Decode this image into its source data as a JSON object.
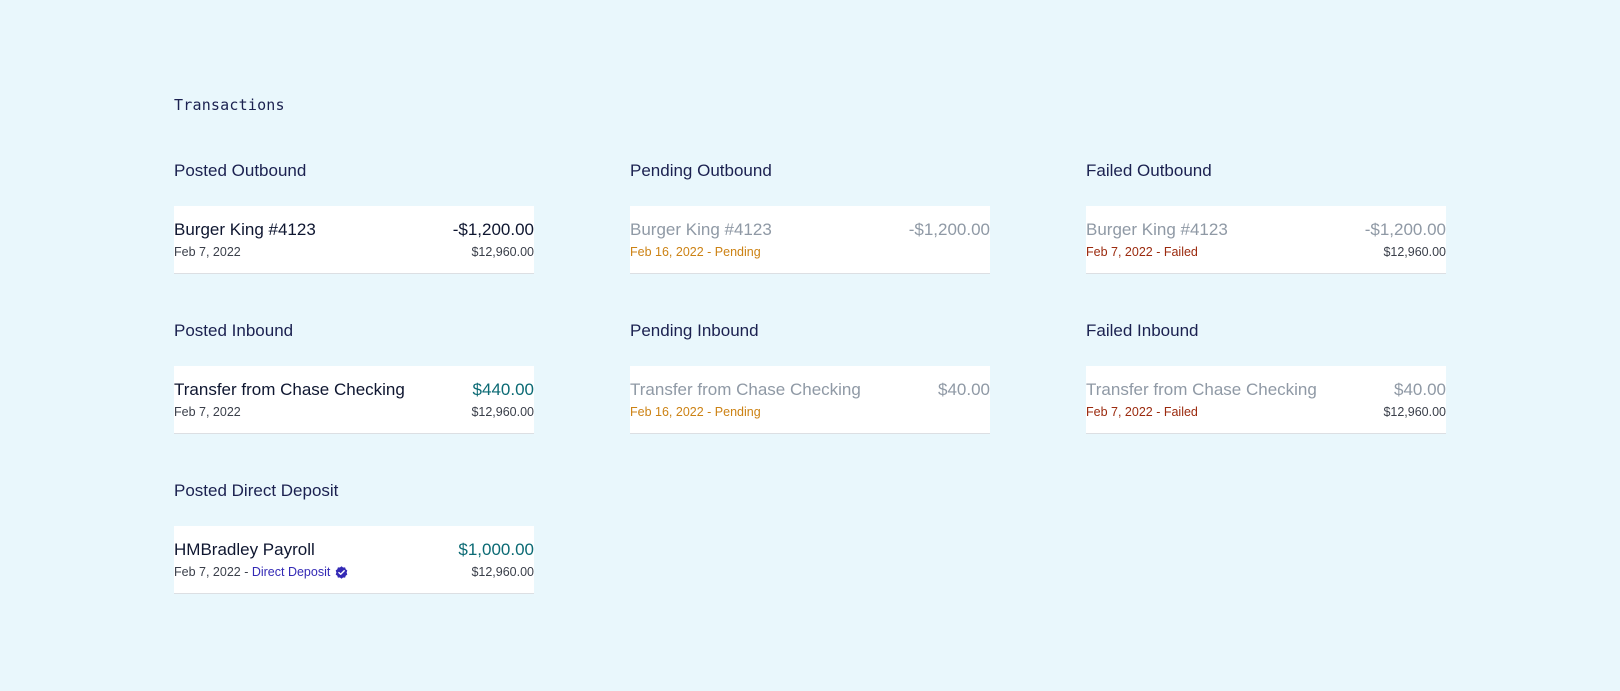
{
  "page_title": "Transactions",
  "sections": [
    {
      "title": "Posted Outbound",
      "description": "Burger King #4123",
      "amount": "-$1,200.00",
      "date": "Feb 7, 2022",
      "balance": "$12,960.00"
    },
    {
      "title": "Pending Outbound",
      "description": "Burger King #4123",
      "amount": "-$1,200.00",
      "date": "Feb 16, 2022 - Pending",
      "balance": ""
    },
    {
      "title": "Failed Outbound",
      "description": "Burger King #4123",
      "amount": "-$1,200.00",
      "date": "Feb 7, 2022 - Failed",
      "balance": "$12,960.00"
    },
    {
      "title": "Posted Inbound",
      "description": "Transfer from Chase Checking",
      "amount": "$440.00",
      "date": "Feb 7, 2022",
      "balance": "$12,960.00"
    },
    {
      "title": "Pending Inbound",
      "description": "Transfer from Chase Checking",
      "amount": "$40.00",
      "date": "Feb 16, 2022 - Pending",
      "balance": ""
    },
    {
      "title": "Failed Inbound",
      "description": "Transfer from Chase Checking",
      "amount": "$40.00",
      "date": "Feb 7, 2022 - Failed",
      "balance": "$12,960.00"
    },
    {
      "title": "Posted Direct Deposit",
      "description": "HMBradley Payroll",
      "amount": "$1,000.00",
      "date": "Feb 7, 2022 - ",
      "date_tag": "Direct Deposit",
      "balance": "$12,960.00",
      "verified_icon": "check-circle-icon"
    }
  ],
  "colors": {
    "background": "#e9f7fc",
    "heading": "#1b2150",
    "credit_amount": "#0b6a74",
    "pending_status": "#cc8214",
    "failed_status": "#9b2a0e",
    "direct_deposit": "#3329b5",
    "muted_text": "#8f99a5"
  }
}
